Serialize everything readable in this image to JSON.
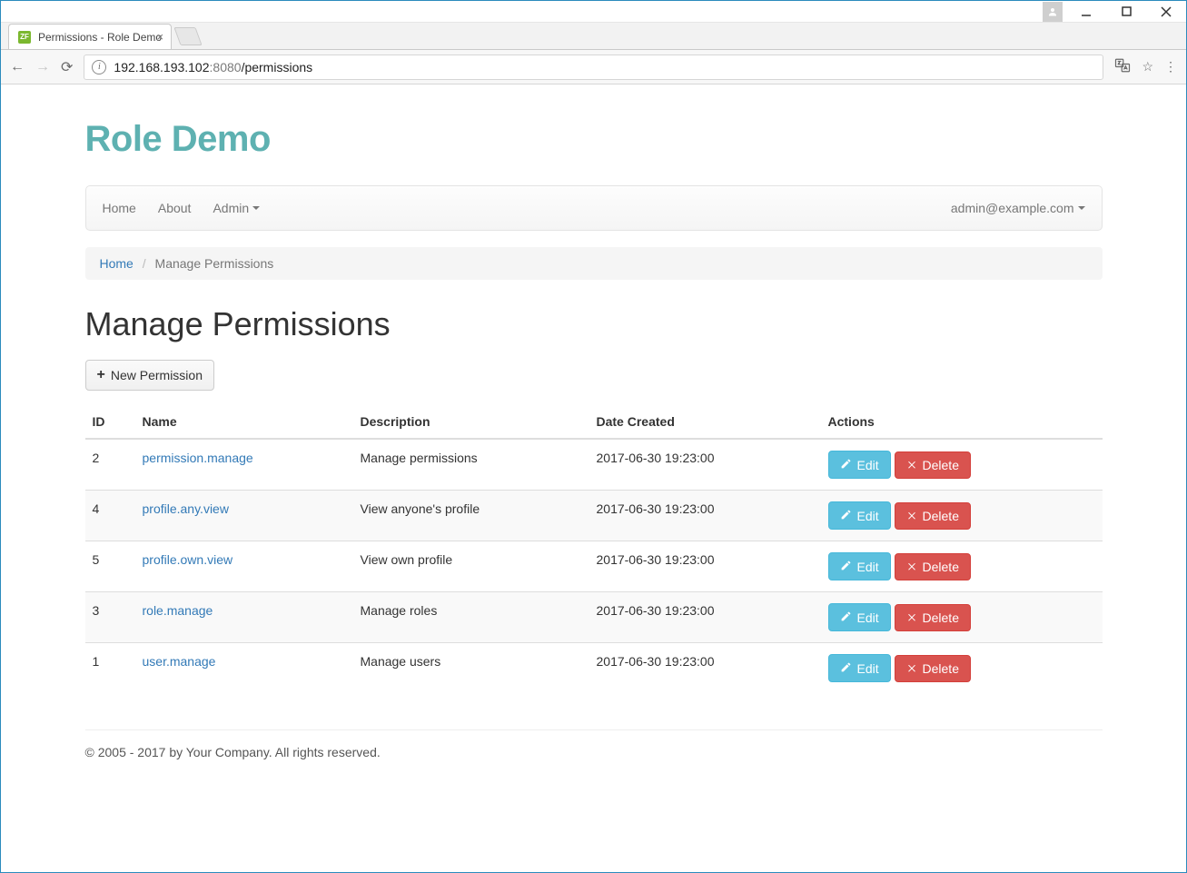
{
  "browser": {
    "tab_title": "Permissions - Role Demo",
    "url_host": "192.168.193.102",
    "url_port": ":8080",
    "url_path": "/permissions"
  },
  "brand": "Role Demo",
  "navbar": {
    "home": "Home",
    "about": "About",
    "admin": "Admin",
    "user_menu": "admin@example.com"
  },
  "breadcrumb": {
    "home": "Home",
    "current": "Manage Permissions"
  },
  "page_title": "Manage Permissions",
  "new_permission_label": "New Permission",
  "columns": {
    "id": "ID",
    "name": "Name",
    "description": "Description",
    "date_created": "Date Created",
    "actions": "Actions"
  },
  "action_labels": {
    "edit": "Edit",
    "delete": "Delete"
  },
  "rows": [
    {
      "id": "2",
      "name": "permission.manage",
      "description": "Manage permissions",
      "date": "2017-06-30 19:23:00"
    },
    {
      "id": "4",
      "name": "profile.any.view",
      "description": "View anyone's profile",
      "date": "2017-06-30 19:23:00"
    },
    {
      "id": "5",
      "name": "profile.own.view",
      "description": "View own profile",
      "date": "2017-06-30 19:23:00"
    },
    {
      "id": "3",
      "name": "role.manage",
      "description": "Manage roles",
      "date": "2017-06-30 19:23:00"
    },
    {
      "id": "1",
      "name": "user.manage",
      "description": "Manage users",
      "date": "2017-06-30 19:23:00"
    }
  ],
  "footer": "© 2005 - 2017 by Your Company. All rights reserved."
}
